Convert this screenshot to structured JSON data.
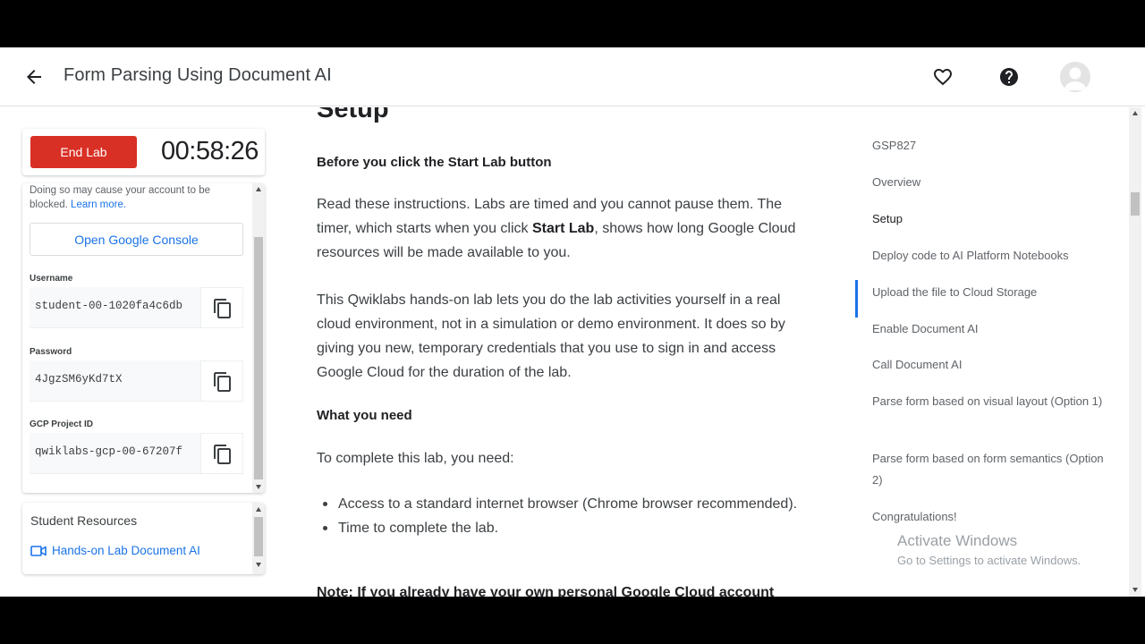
{
  "header": {
    "title": "Form Parsing Using Document AI"
  },
  "timer_card": {
    "end_lab_label": "End Lab",
    "time_remaining": "00:58:26"
  },
  "credentials": {
    "warning_text": "Doing so may cause your account to be blocked.",
    "learn_more": "Learn more.",
    "open_console_label": "Open Google Console",
    "username_label": "Username",
    "username_value": "student-00-1020fa4c6db",
    "password_label": "Password",
    "password_value": "4JgzSM6yKd7tX",
    "project_label": "GCP Project ID",
    "project_value": "qwiklabs-gcp-00-67207f"
  },
  "resources": {
    "title": "Student Resources",
    "link_label": "Hands-on Lab Document AI"
  },
  "main": {
    "section_heading": "Setup",
    "before_heading": "Before you click the Start Lab button",
    "para1_a": "Read these instructions. Labs are timed and you cannot pause them. The timer, which starts when you click ",
    "para1_bold": "Start Lab",
    "para1_b": ", shows how long Google Cloud resources will be made available to you.",
    "para2": "This Qwiklabs hands-on lab lets you do the lab activities yourself in a real cloud environment, not in a simulation or demo environment. It does so by giving you new, temporary credentials that you use to sign in and access Google Cloud for the duration of the lab.",
    "need_heading": "What you need",
    "need_intro": "To complete this lab, you need:",
    "need_items": [
      "Access to a standard internet browser (Chrome browser recommended).",
      "Time to complete the lab."
    ],
    "cutoff_text": "Note: If you already have your own personal Google Cloud account"
  },
  "toc": {
    "items": [
      "GSP827",
      "Overview",
      "Setup",
      "Deploy code to AI Platform Notebooks",
      "Upload the file to Cloud Storage",
      "Enable Document AI",
      "Call Document AI",
      "Parse form based on visual layout (Option 1)",
      "Parse form based on form semantics (Option 2)",
      "Congratulations!"
    ],
    "active_index": 2
  },
  "watermark": {
    "line1": "Activate Windows",
    "line2": "Go to Settings to activate Windows."
  },
  "icons": {
    "back": "arrow-back-icon",
    "favorite": "heart-icon",
    "help": "help-circle-icon",
    "avatar": "account-avatar-icon",
    "copy": "copy-icon",
    "video": "video-camera-icon"
  },
  "colors": {
    "end_lab_red": "#d93025",
    "link_blue": "#1a73e8",
    "text_dark": "#202124",
    "text_grey": "#5f6368"
  }
}
